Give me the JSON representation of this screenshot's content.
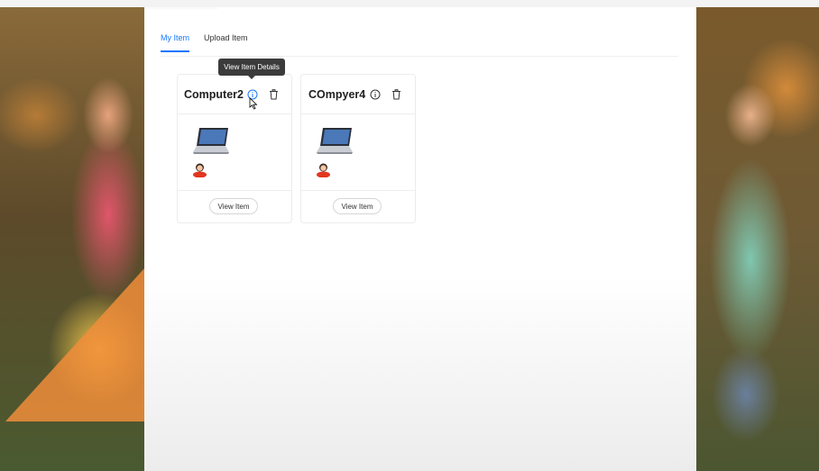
{
  "tabs": [
    {
      "label": "My Item",
      "active": true
    },
    {
      "label": "Upload Item",
      "active": false
    }
  ],
  "items": [
    {
      "title": "Computer2",
      "view_label": "View Item"
    },
    {
      "title": "COmpyer4",
      "view_label": "View Item"
    }
  ],
  "tooltip": {
    "text": "View Item Details"
  },
  "icons": {
    "info": "info-circle-icon",
    "delete": "trash-icon",
    "thumbnail": "laptop-icon",
    "owner": "avatar-icon",
    "pointer": "cursor-icon"
  },
  "colors": {
    "accent": "#1677ff",
    "tooltip_bg": "#3b3b3b"
  }
}
